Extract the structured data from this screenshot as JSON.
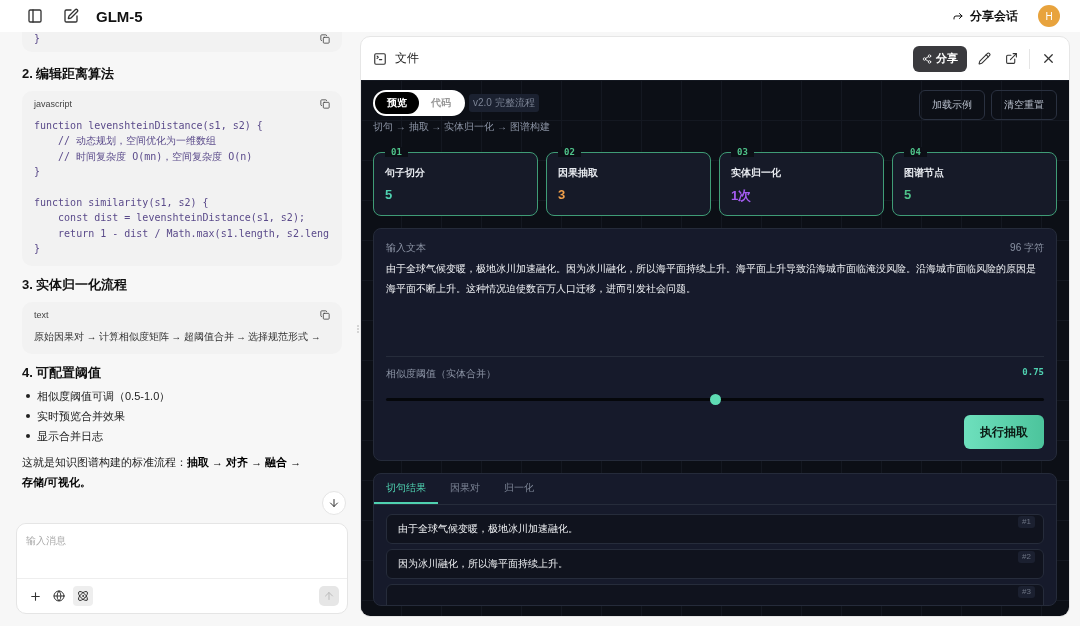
{
  "topbar": {
    "title": "GLM-5",
    "share_label": "分享会话",
    "avatar": "H"
  },
  "chat": {
    "blocks": [
      {
        "kind": "code_end",
        "lines": [
          "}"
        ]
      },
      {
        "kind": "heading",
        "text": "2. 编辑距离算法"
      },
      {
        "kind": "code",
        "lang": "javascript",
        "groups": [
          [
            "function levenshteinDistance(s1, s2) {",
            "    // 动态规划，空间优化为一维数组",
            "    // 时间复杂度 O(mn)，空间复杂度 O(n)",
            "}"
          ],
          [
            "function similarity(s1, s2) {",
            "    const dist = levenshteinDistance(s1, s2);",
            "    return 1 - dist / Math.max(s1.length, s2.leng",
            "}"
          ]
        ]
      },
      {
        "kind": "heading",
        "text": "3. 实体归一化流程"
      },
      {
        "kind": "code",
        "lang": "text",
        "groups": [
          [
            "原始因果对 → 计算相似度矩阵 → 超阈值合并 → 选择规范形式 →"
          ]
        ]
      },
      {
        "kind": "heading",
        "text": "4. 可配置阈值"
      },
      {
        "kind": "bullets",
        "items": [
          "相似度阈值可调（0.5-1.0）",
          "实时预览合并效果",
          "显示合并日志"
        ]
      },
      {
        "kind": "paragraph",
        "text": "这就是知识图谱构建的标准流程：**抽取 → 对齐 → 融合 → 存储/可视化。**"
      }
    ],
    "composer": {
      "placeholder": "输入消息",
      "tools": [
        {
          "kind": "plus",
          "selected": false
        },
        {
          "kind": "globe",
          "selected": false
        },
        {
          "kind": "atom",
          "selected": true
        }
      ]
    }
  },
  "panel": {
    "title": "文件",
    "share_label": "分享",
    "view_tabs": [
      {
        "label": "预览",
        "selected": true
      },
      {
        "label": "代码",
        "selected": false
      }
    ],
    "version": "v2.0 完整流程",
    "pipeline": "切句 → 抽取 → 实体归一化 → 图谱构建",
    "actions": [
      "加载示例",
      "清空重置"
    ],
    "stats": [
      {
        "index": "01",
        "label": "句子切分",
        "value": "5",
        "color": "#4fd1b0"
      },
      {
        "index": "02",
        "label": "因果抽取",
        "value": "3",
        "color": "#f0a04b"
      },
      {
        "index": "03",
        "label": "实体归一化",
        "value": "1次",
        "color": "#a55cf0"
      },
      {
        "index": "04",
        "label": "图谱节点",
        "value": "5",
        "color": "#4fc38a"
      }
    ],
    "input": {
      "label": "输入文本",
      "count": "96 字符",
      "text": "由于全球气候变暖，极地冰川加速融化。因为冰川融化，所以海平面持续上升。海平面上升导致沿海城市面临淹没风险。沿海城市面临风险的原因是海平面不断上升。这种情况迫使数百万人口迁移，进而引发社会问题。",
      "slider_label": "相似度阈值（实体合并）",
      "slider_value": "0.75",
      "level": 0.5,
      "run_label": "执行抽取"
    },
    "result_tabs": [
      {
        "label": "切句结果",
        "selected": true
      },
      {
        "label": "因果对",
        "selected": false
      },
      {
        "label": "归一化",
        "selected": false
      }
    ],
    "sentences": [
      {
        "index": "#1",
        "text": "由于全球气候变暖，极地冰川加速融化。"
      },
      {
        "index": "#2",
        "text": "因为冰川融化，所以海平面持续上升。"
      },
      {
        "index": "#3"
      }
    ]
  }
}
